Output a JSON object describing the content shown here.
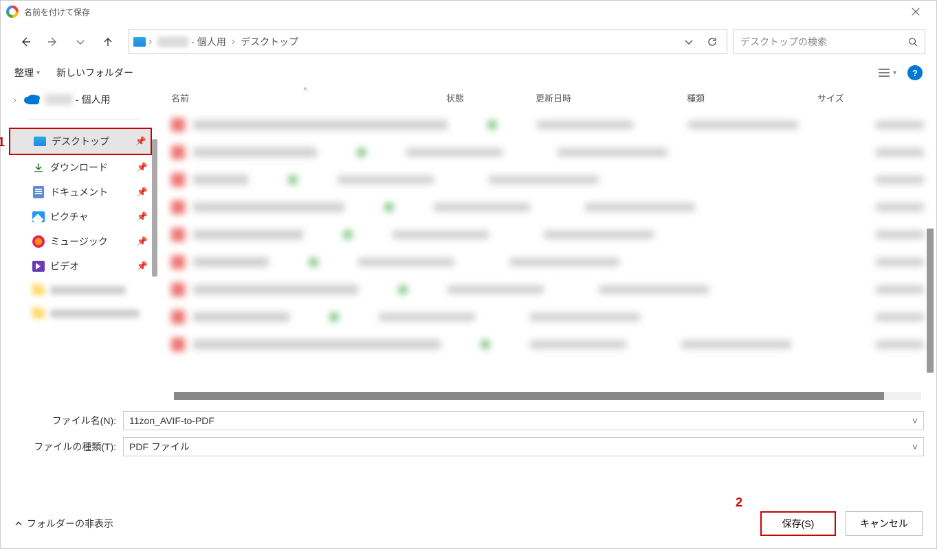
{
  "window": {
    "title": "名前を付けて保存"
  },
  "breadcrumb": {
    "personal_suffix": "- 個人用",
    "leaf": "デスクトップ"
  },
  "search": {
    "placeholder": "デスクトップの検索"
  },
  "toolbar": {
    "organize": "整理",
    "new_folder": "新しいフォルダー"
  },
  "tree": {
    "onedrive_suffix": "- 個人用",
    "desktop": "デスクトップ",
    "downloads": "ダウンロード",
    "documents": "ドキュメント",
    "pictures": "ピクチャ",
    "music": "ミュージック",
    "videos": "ビデオ"
  },
  "columns": {
    "name": "名前",
    "state": "状態",
    "modified": "更新日時",
    "type": "種類",
    "size": "サイズ"
  },
  "form": {
    "filename_label": "ファイル名(N):",
    "filename_value": "11zon_AVIF-to-PDF",
    "filetype_label": "ファイルの種類(T):",
    "filetype_value": "PDF ファイル"
  },
  "footer": {
    "hide_folders": "フォルダーの非表示",
    "save": "保存(S)",
    "cancel": "キャンセル"
  },
  "annotations": {
    "one": "1",
    "two": "2"
  }
}
